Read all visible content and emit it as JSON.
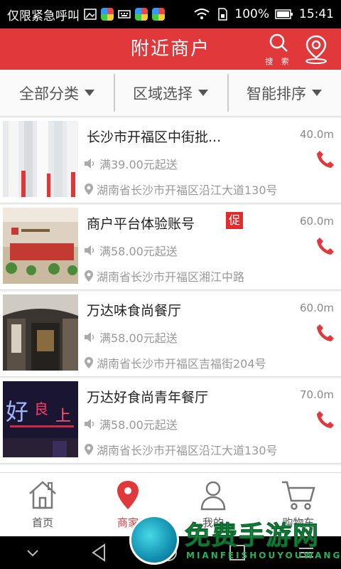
{
  "statusbar": {
    "carrier": "仅限紧急呼叫",
    "battery": "100%",
    "time": "15:41"
  },
  "header": {
    "title": "附近商户",
    "search_label": "搜 索"
  },
  "filters": [
    {
      "label": "全部分类"
    },
    {
      "label": "区域选择"
    },
    {
      "label": "智能排序"
    }
  ],
  "merchants": [
    {
      "name": "长沙市开福区中街批...",
      "distance": "40.0m",
      "min_order": "满39.00元起送",
      "address": "湖南省长沙市开福区沿江大道130号",
      "promo": ""
    },
    {
      "name": "商户平台体验账号",
      "distance": "60.0m",
      "min_order": "满58.00元起送",
      "address": "湖南省长沙市开福区湘江中路",
      "promo": "促"
    },
    {
      "name": "万达味食尚餐厅",
      "distance": "60.0m",
      "min_order": "满58.00元起送",
      "address": "湖南省长沙市开福区吉福街204号",
      "promo": ""
    },
    {
      "name": "万达好食尚青年餐厅",
      "distance": "70.0m",
      "min_order": "满58.00元起送",
      "address": "湖南省长沙市开福区沿江大道130号",
      "promo": ""
    }
  ],
  "tabs": [
    {
      "label": "首页"
    },
    {
      "label": "商家"
    },
    {
      "label": "我的"
    },
    {
      "label": "购物车"
    }
  ],
  "watermark": {
    "text": "免费手游网",
    "sub": "MIANFEISHOUYOUWANG"
  },
  "colors": {
    "accent": "#e0383b",
    "phone": "#e0383b"
  }
}
